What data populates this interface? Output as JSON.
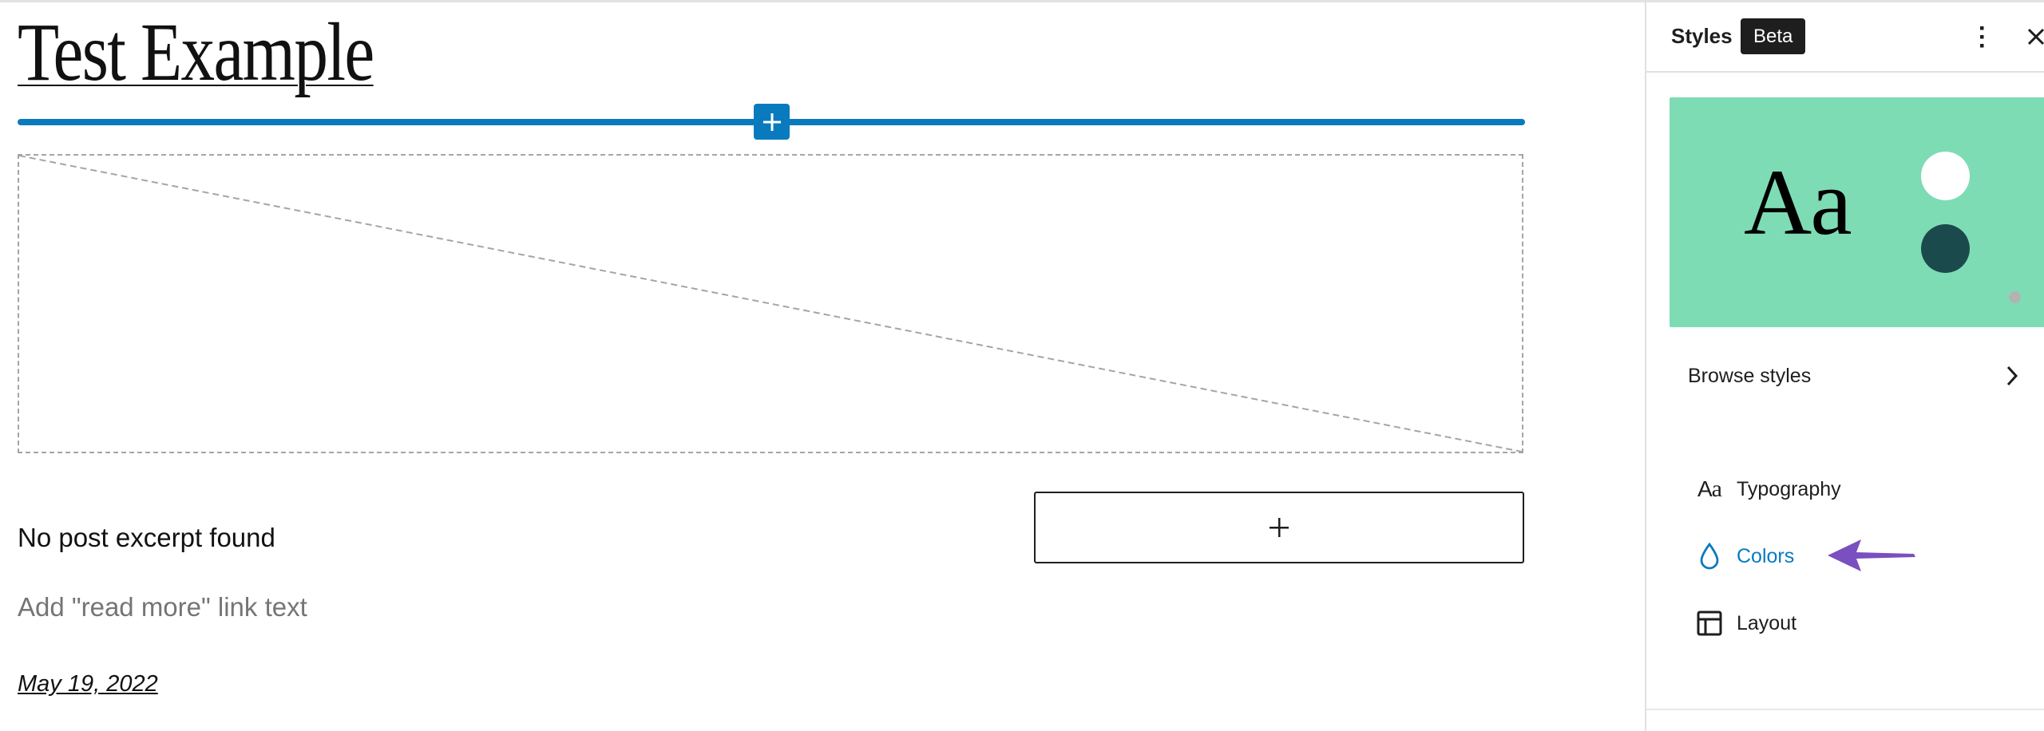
{
  "editor": {
    "post_title": "Test Example",
    "inserter_button_label": "+",
    "featured_image_placeholder": "",
    "excerpt_text": "No post excerpt found",
    "read_more_placeholder": "Add \"read more\" link text",
    "post_date": "May 19, 2022",
    "append_block_label": "+"
  },
  "sidebar": {
    "title": "Styles",
    "badge": "Beta",
    "options_icon": "more-vertical-icon",
    "close_icon": "close-icon",
    "preview": {
      "sample_text": "Aa",
      "background_color": "#7edcb5",
      "swatches": [
        "#ffffff",
        "#1b4a4c"
      ]
    },
    "browse_styles_label": "Browse styles",
    "nav_items": [
      {
        "label": "Typography",
        "icon": "typography-icon",
        "active": false
      },
      {
        "label": "Colors",
        "icon": "droplet-icon",
        "active": true
      },
      {
        "label": "Layout",
        "icon": "layout-icon",
        "active": false
      }
    ]
  },
  "colors": {
    "accent": "#0a7abf",
    "annotation_arrow": "#7a4fbf",
    "text": "#1e1e1e",
    "placeholder_text": "#757575"
  }
}
